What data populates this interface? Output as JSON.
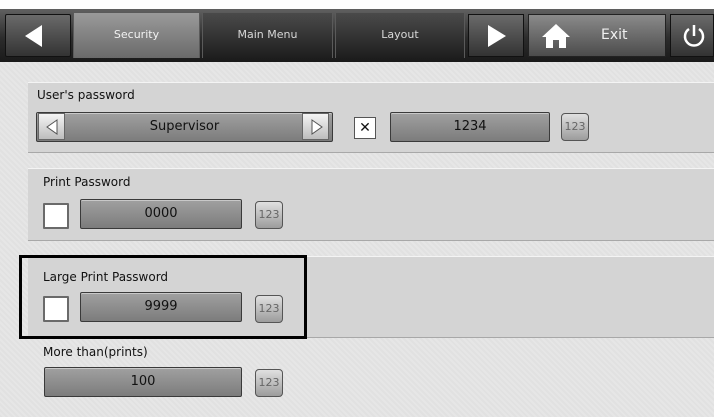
{
  "nav": {
    "tabs": [
      {
        "label": "Security",
        "active": true
      },
      {
        "label": "Main Menu",
        "active": false
      },
      {
        "label": "Layout",
        "active": false
      }
    ],
    "exit_label": "Exit",
    "icons": [
      "arrow-left-icon",
      "arrow-right-icon",
      "home-icon",
      "power-icon"
    ]
  },
  "users_password": {
    "label": "User's password",
    "user_value": "Supervisor",
    "checkbox_mark": "✕",
    "checked": true,
    "password_value": "1234",
    "keypad_label": "123"
  },
  "print_password": {
    "label": "Print Password",
    "checked": false,
    "value": "0000",
    "keypad_label": "123"
  },
  "large_print_password": {
    "label": "Large Print Password",
    "checked": false,
    "value": "9999",
    "keypad_label": "123"
  },
  "more_than_prints": {
    "label": "More than(prints)",
    "value": "100",
    "keypad_label": "123"
  },
  "colors": {
    "nav_dark": "#1e1e1e",
    "active_tab": "#8a8a8a",
    "field_gray": "#8c8c8c",
    "panel_gray": "#d4d4d4"
  }
}
